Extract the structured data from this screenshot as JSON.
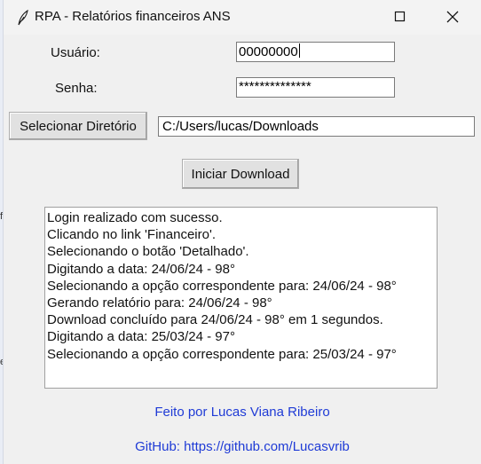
{
  "window": {
    "title": "RPA - Relatórios financeiros ANS"
  },
  "form": {
    "user_label": "Usuário:",
    "user_value": "00000000",
    "password_label": "Senha:",
    "password_value": "**************",
    "select_dir_label": "Selecionar Diretório",
    "dir_value": "C:/Users/lucas/Downloads",
    "start_label": "Iniciar Download"
  },
  "log": {
    "lines": [
      "Login realizado com sucesso.",
      "Clicando no link 'Financeiro'.",
      "Selecionando o botão 'Detalhado'.",
      "Digitando a data: 24/06/24 - 98°",
      "Selecionando a opção correspondente para: 24/06/24 - 98°",
      "Gerando relatório para: 24/06/24 - 98°",
      "Download concluído para 24/06/24 - 98° em 1 segundos.",
      "Digitando a data: 25/03/24 - 97°",
      "Selecionando a opção correspondente para: 25/03/24 - 97°"
    ]
  },
  "footer": {
    "credit": "Feito por Lucas Viana Ribeiro",
    "github": "GitHub: https://github.com/Lucasvrib"
  },
  "background_edge": {
    "mark_1": "f",
    "mark_2": "e"
  },
  "colors": {
    "footer_text": "#1f3bd6",
    "window_bg": "#f0f0f0",
    "titlebar_bg": "#f3f3f3"
  },
  "icons": {
    "app": "feather-icon",
    "minimize": "minimize-icon",
    "maximize": "maximize-icon",
    "close": "close-icon"
  }
}
